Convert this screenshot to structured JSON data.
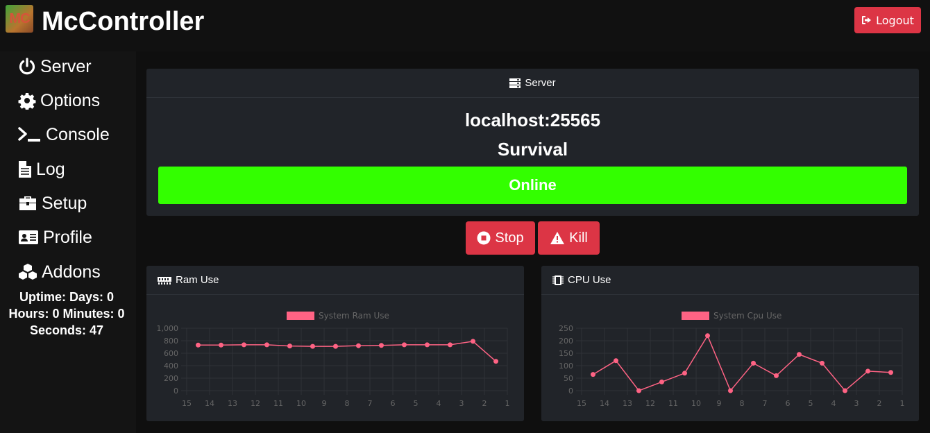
{
  "app": {
    "logo_text": "MC",
    "title": "McController",
    "logout_label": "Logout"
  },
  "sidebar": {
    "items": [
      {
        "label": "Server",
        "icon": "power-icon"
      },
      {
        "label": "Options",
        "icon": "gear-icon"
      },
      {
        "label": "Console",
        "icon": "terminal-icon"
      },
      {
        "label": "Log",
        "icon": "file-icon"
      },
      {
        "label": "Setup",
        "icon": "briefcase-icon"
      },
      {
        "label": "Profile",
        "icon": "id-card-icon"
      },
      {
        "label": "Addons",
        "icon": "cubes-icon"
      }
    ],
    "uptime": {
      "line1": "Uptime: Days: 0",
      "line2": "Hours: 0 Minutes: 0",
      "line3": "Seconds: 47"
    }
  },
  "server": {
    "header": "Server",
    "address": "localhost:25565",
    "world": "Survival",
    "status": "Online",
    "status_color": "#33ff00",
    "stop_label": "Stop",
    "kill_label": "Kill"
  },
  "chart_data": [
    {
      "type": "line",
      "title": "Ram Use",
      "series": [
        {
          "name": "System Ram Use",
          "values": [
            730,
            730,
            735,
            735,
            715,
            710,
            710,
            720,
            725,
            735,
            735,
            735,
            790,
            470
          ],
          "color": "#ff6384"
        }
      ],
      "x": [
        "15",
        "14",
        "13",
        "12",
        "11",
        "10",
        "9",
        "8",
        "7",
        "6",
        "5",
        "4",
        "3",
        "2",
        "1"
      ],
      "yticks": [
        "1,000",
        "800",
        "600",
        "400",
        "200",
        "0"
      ],
      "ylim": [
        0,
        1000
      ],
      "legend": "top"
    },
    {
      "type": "line",
      "title": "CPU Use",
      "series": [
        {
          "name": "System Cpu Use",
          "values": [
            65,
            120,
            0,
            35,
            70,
            220,
            0,
            110,
            60,
            145,
            110,
            0,
            78,
            73
          ],
          "color": "#ff6384"
        }
      ],
      "x": [
        "15",
        "14",
        "13",
        "12",
        "11",
        "10",
        "9",
        "8",
        "7",
        "6",
        "5",
        "4",
        "3",
        "2",
        "1"
      ],
      "yticks": [
        "250",
        "200",
        "150",
        "100",
        "50",
        "0"
      ],
      "ylim": [
        0,
        250
      ],
      "legend": "top"
    }
  ]
}
